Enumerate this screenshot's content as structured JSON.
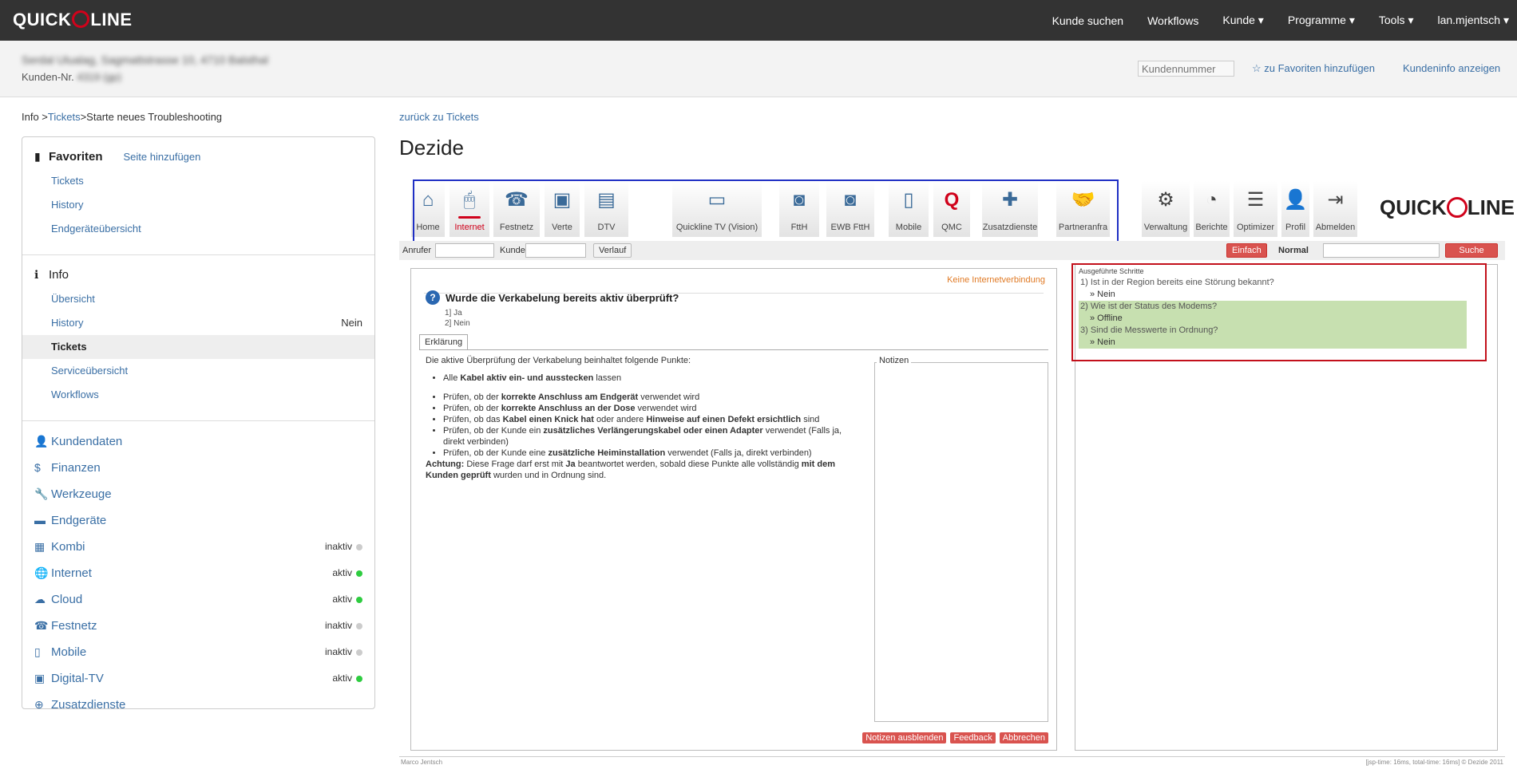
{
  "topbar": {
    "logo": "QUICKLINE",
    "logo_left": "QUICK",
    "logo_right": "LINE",
    "nav": [
      "Kunde suchen",
      "Workflows",
      "Kunde ▾",
      "Programme ▾",
      "Tools ▾",
      "lan.mjentsch ▾"
    ]
  },
  "customer": {
    "name": "Serdal Ulualag, Sagmattstrasse 10, 4710 Balsthal",
    "nr_label": "Kunden-Nr.",
    "nr_value": "4319 (gp)",
    "search_placeholder": "Kundennummer",
    "fav_link": "☆ zu Favoriten hinzufügen",
    "info_link": "Kundeninfo anzeigen"
  },
  "breadcrumb": {
    "info": "Info >",
    "tickets": "Tickets",
    "rest": ">Starte neues Troubleshooting"
  },
  "sidebar": {
    "fav": {
      "title": "Favoriten",
      "add": "Seite hinzufügen",
      "items": [
        "Tickets",
        "History",
        "Endgeräteübersicht"
      ]
    },
    "info": {
      "title": "Info",
      "items": [
        {
          "label": "Übersicht",
          "right": ""
        },
        {
          "label": "History",
          "right": "Nein"
        },
        {
          "label": "Tickets",
          "right": ""
        },
        {
          "label": "Serviceübersicht",
          "right": ""
        },
        {
          "label": "Workflows",
          "right": ""
        }
      ]
    },
    "main": [
      {
        "label": "Kundendaten",
        "icon": "👤",
        "status": ""
      },
      {
        "label": "Finanzen",
        "icon": "$",
        "status": ""
      },
      {
        "label": "Werkzeuge",
        "icon": "🔧",
        "status": ""
      },
      {
        "label": "Endgeräte",
        "icon": "▬",
        "status": ""
      },
      {
        "label": "Kombi",
        "icon": "▦",
        "status": "inaktiv"
      },
      {
        "label": "Internet",
        "icon": "🌐",
        "status": "aktiv"
      },
      {
        "label": "Cloud",
        "icon": "☁",
        "status": "aktiv"
      },
      {
        "label": "Festnetz",
        "icon": "☎",
        "status": "inaktiv"
      },
      {
        "label": "Mobile",
        "icon": "▯",
        "status": "inaktiv"
      },
      {
        "label": "Digital-TV",
        "icon": "▣",
        "status": "aktiv"
      },
      {
        "label": "Zusatzdienste",
        "icon": "⊕",
        "status": ""
      }
    ]
  },
  "main": {
    "back": "zurück zu Tickets",
    "title": "Dezide"
  },
  "tools": [
    "Home",
    "Internet",
    "Festnetz",
    "Verte",
    "DTV",
    "Quickline TV (Vision)",
    "FttH",
    "EWB FttH",
    "Mobile",
    "QMC",
    "Zusatzdienste",
    "Partneranfra"
  ],
  "admin": [
    "Verwaltung",
    "Berichte",
    "Optimizer",
    "Profil",
    "Abmelden"
  ],
  "subbar": {
    "anrufer": "Anrufer",
    "kunde": "Kunde",
    "verlauf": "Verlauf",
    "einfach": "Einfach",
    "normal": "Normal",
    "suche": "Suche"
  },
  "question": {
    "no_internet": "Keine Internetverbindung",
    "text": "Wurde die Verkabelung bereits aktiv überprüft?",
    "a1": "1] Ja",
    "a2": "2] Nein",
    "tab": "Erklärung",
    "notes_label": "Notizen"
  },
  "explain": {
    "intro": "Die aktive Überprüfung der Verkabelung beinhaltet folgende Punkte:",
    "b1a": "Alle ",
    "b1b": "Kabel aktiv ein- und ausstecken",
    "b1c": " lassen",
    "b2a": "Prüfen, ob der ",
    "b2b": "korrekte Anschluss am Endgerät",
    "b2c": " verwendet wird",
    "b3a": "Prüfen, ob der ",
    "b3b": "korrekte Anschluss an der Dose",
    "b3c": " verwendet wird",
    "b4a": "Prüfen, ob das ",
    "b4b": "Kabel einen Knick hat",
    "b4c": " oder andere ",
    "b4d": "Hinweise auf einen Defekt ersichtlich",
    "b4e": " sind",
    "b5a": "Prüfen, ob der Kunde ein ",
    "b5b": "zusätzliches Verlängerungskabel oder einen Adapter",
    "b5c": " verwendet (Falls ja, direkt verbinden)",
    "b6a": "Prüfen, ob der Kunde eine ",
    "b6b": "zusätzliche Heiminstallation",
    "b6c": " verwendet (Falls ja, direkt verbinden)",
    "w1": "Achtung:",
    "w2": " Diese Frage darf erst mit ",
    "w3": "Ja",
    "w4": " beantwortet werden, sobald diese Punkte alle vollständig ",
    "w5": "mit dem Kunden geprüft",
    "w6": " wurden und in Ordnung sind."
  },
  "buttons": {
    "hide": "Notizen ausblenden",
    "feedback": "Feedback",
    "cancel": "Abbrechen"
  },
  "steps": {
    "title": "Ausgeführte Schritte",
    "s1": "1) Ist in der Region bereits eine Störung bekannt?",
    "a1": "» Nein",
    "s2": "2) Wie ist der Status des Modems?",
    "a2": "» Offline",
    "s3": "3) Sind die Messwerte in Ordnung?",
    "a3": "» Nein"
  },
  "footer": {
    "left": "Marco Jentsch",
    "right": "[jsp-time: 16ms, total-time: 16ms] © Dezide 2011"
  },
  "colors": {
    "accent": "#d0021b",
    "link": "#3a6fa5",
    "topbar": "#333333",
    "status_active": "#2ecc40",
    "status_inactive": "#cccccc"
  }
}
